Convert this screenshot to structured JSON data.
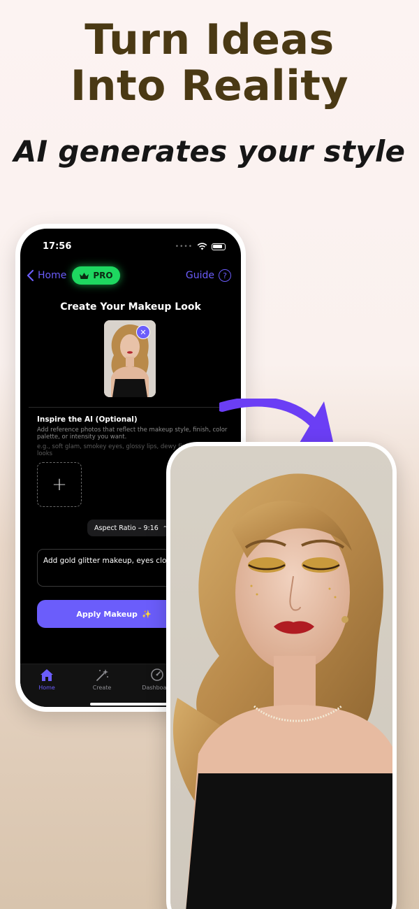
{
  "headline": {
    "line1": "Turn Ideas",
    "line2": "Into Reality"
  },
  "subheadline": "AI generates your style",
  "phone": {
    "status_bar": {
      "time": "17:56"
    },
    "nav": {
      "back_label": "Home",
      "pro_label": "PRO",
      "guide_label": "Guide",
      "help_symbol": "?"
    },
    "screen_title": "Create Your Makeup Look",
    "remove_symbol": "✕",
    "inspire": {
      "title": "Inspire the AI (Optional)",
      "description": "Add reference photos that reflect the makeup style, finish, color palette, or intensity you want.",
      "example": "e.g., soft glam, smokey eyes, glossy lips, dewy finish, monochrome looks"
    },
    "add_symbol": "+",
    "aspect_ratio_label": "Aspect Ratio – 9:16",
    "aspect_chevron": "⌃⌄",
    "prompt_text": "Add gold glitter makeup, eyes closed",
    "apply_button": {
      "label": "Apply Makeup",
      "emoji": "✨"
    },
    "tabs": [
      {
        "label": "Home",
        "icon": "house-icon",
        "active": true
      },
      {
        "label": "Create",
        "icon": "magic-wand-icon",
        "active": false
      },
      {
        "label": "Dashboard",
        "icon": "gauge-icon",
        "active": false
      }
    ]
  },
  "colors": {
    "accent": "#6b5dfb",
    "pro_green": "#1ed760",
    "headline": "#4a3914",
    "phone_background": "#000000"
  }
}
